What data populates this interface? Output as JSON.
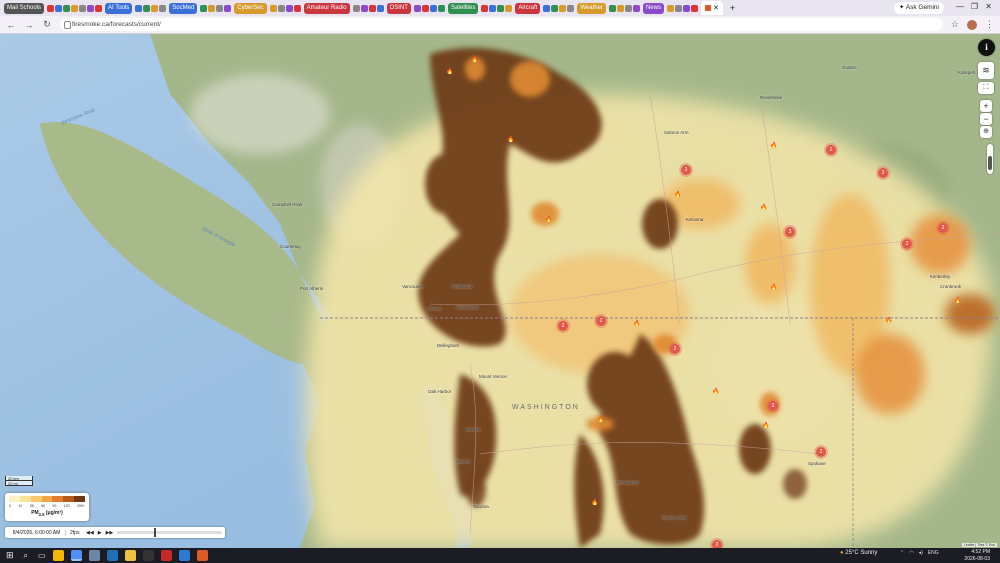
{
  "browser": {
    "tabs": [
      {
        "label": "Mail Schools",
        "color": "#555555"
      },
      {
        "label": "AI Tools",
        "color": "#3a6fd8"
      },
      {
        "label": "SocMed",
        "color": "#3a6fd8"
      },
      {
        "label": "CyberSec",
        "color": "#d89a2a"
      },
      {
        "label": "Amateur Radio",
        "color": "#c9363d"
      },
      {
        "label": "OSINT",
        "color": "#c9363d"
      },
      {
        "label": "Satellites",
        "color": "#2f8f4f"
      },
      {
        "label": "Aircraft",
        "color": "#c9363d"
      },
      {
        "label": "Weather",
        "color": "#d89a2a"
      },
      {
        "label": "News",
        "color": "#8b4ac8"
      }
    ],
    "ask_gemini": "Ask Gemini",
    "url": "firesmoke.ca/forecasts/current/"
  },
  "map": {
    "places": [
      {
        "name": "Campbell River"
      },
      {
        "name": "Courtenay"
      },
      {
        "name": "Port Alberni"
      },
      {
        "name": "Vancouver"
      },
      {
        "name": "Chilliwack"
      },
      {
        "name": "Abbotsford"
      },
      {
        "name": "Surrey"
      },
      {
        "name": "Bellingham"
      },
      {
        "name": "Mount Vernon"
      },
      {
        "name": "Oak Harbor"
      },
      {
        "name": "Everett"
      },
      {
        "name": "Seattle"
      },
      {
        "name": "Tacoma"
      },
      {
        "name": "Kelowna"
      },
      {
        "name": "Salmon Arm"
      },
      {
        "name": "Revelstoke"
      },
      {
        "name": "Golden"
      },
      {
        "name": "Cranbrook"
      },
      {
        "name": "Kimberley"
      },
      {
        "name": "Spokane"
      },
      {
        "name": "Wenatchee"
      },
      {
        "name": "Moses Lake"
      },
      {
        "name": "Kalispell"
      }
    ],
    "water_labels": [
      "Strait of Georgia",
      "Johnstone Strait"
    ],
    "state_label": "WASHINGTON",
    "scale": {
      "km": "20 km",
      "mi": "20 mi"
    },
    "legend": {
      "title": "PM",
      "title_sub": "2.5",
      "unit": " (μg/m³)",
      "colors": [
        "#fdf1c6",
        "#fbe19a",
        "#f7c86a",
        "#f2a64a",
        "#e37d2e",
        "#b85a1c",
        "#6e3a17"
      ],
      "ticks": [
        "0",
        "10",
        "28",
        "60",
        "90",
        "120",
        "250+"
      ]
    },
    "timebar": {
      "datetime": "8/4/2026, 6:00:00 AM",
      "speed": "2fps",
      "position_fraction": 0.35
    },
    "attribution": "Leaflet | Tiles © Esri",
    "fire_cluster_counts": [
      "2",
      "2",
      "2",
      "2",
      "3",
      "2",
      "3",
      "2",
      "2",
      "3",
      "2",
      "2"
    ]
  },
  "taskbar": {
    "weather": "25°C  Sunny",
    "lang": "ENG",
    "time": "4:52 PM",
    "date": "2026-08-03"
  }
}
